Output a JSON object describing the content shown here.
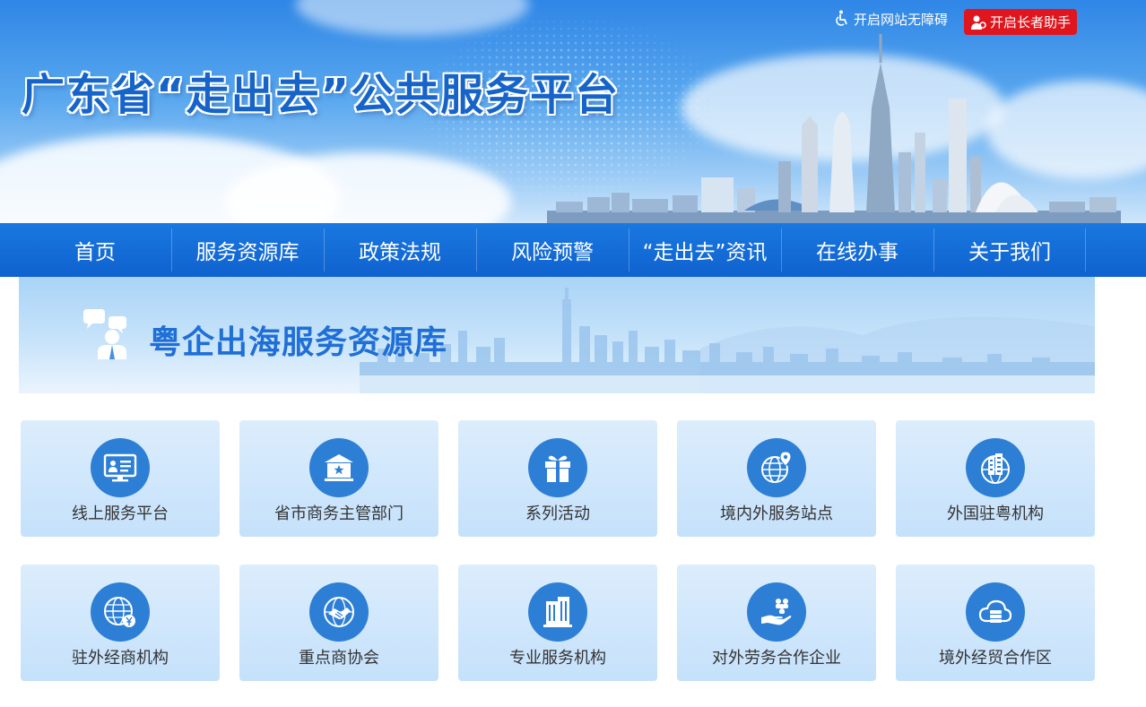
{
  "header": {
    "site_title": "广东省“走出去”公共服务平台",
    "accessibility_label": "开启网站无障碍",
    "elder_mode_label": "开启长者助手"
  },
  "nav": {
    "items": [
      {
        "label": "首页"
      },
      {
        "label": "服务资源库"
      },
      {
        "label": "政策法规"
      },
      {
        "label": "风险预警"
      },
      {
        "label": "“走出去”资讯"
      },
      {
        "label": "在线办事"
      },
      {
        "label": "关于我们"
      }
    ]
  },
  "section": {
    "title": "粤企出海服务资源库",
    "icon": "consultant-icon"
  },
  "cards": [
    {
      "label": "线上服务平台",
      "icon": "monitor-profile-icon"
    },
    {
      "label": "省市商务主管部门",
      "icon": "government-building-icon"
    },
    {
      "label": "系列活动",
      "icon": "gift-icon"
    },
    {
      "label": "境内外服务站点",
      "icon": "globe-location-icon"
    },
    {
      "label": "外国驻粤机构",
      "icon": "globe-buildings-icon"
    },
    {
      "label": "驻外经商机构",
      "icon": "globe-yen-icon"
    },
    {
      "label": "重点商协会",
      "icon": "globe-handshake-icon"
    },
    {
      "label": "专业服务机构",
      "icon": "office-building-icon"
    },
    {
      "label": "对外劳务合作企业",
      "icon": "hand-people-icon"
    },
    {
      "label": "境外经贸合作区",
      "icon": "cloud-server-icon"
    }
  ],
  "colors": {
    "nav_blue": "#1469d6",
    "title_blue": "#1f6fd6",
    "icon_blue": "#2d7fd6",
    "elder_red": "#e0161e",
    "card_bg": "#d4e8fc"
  }
}
